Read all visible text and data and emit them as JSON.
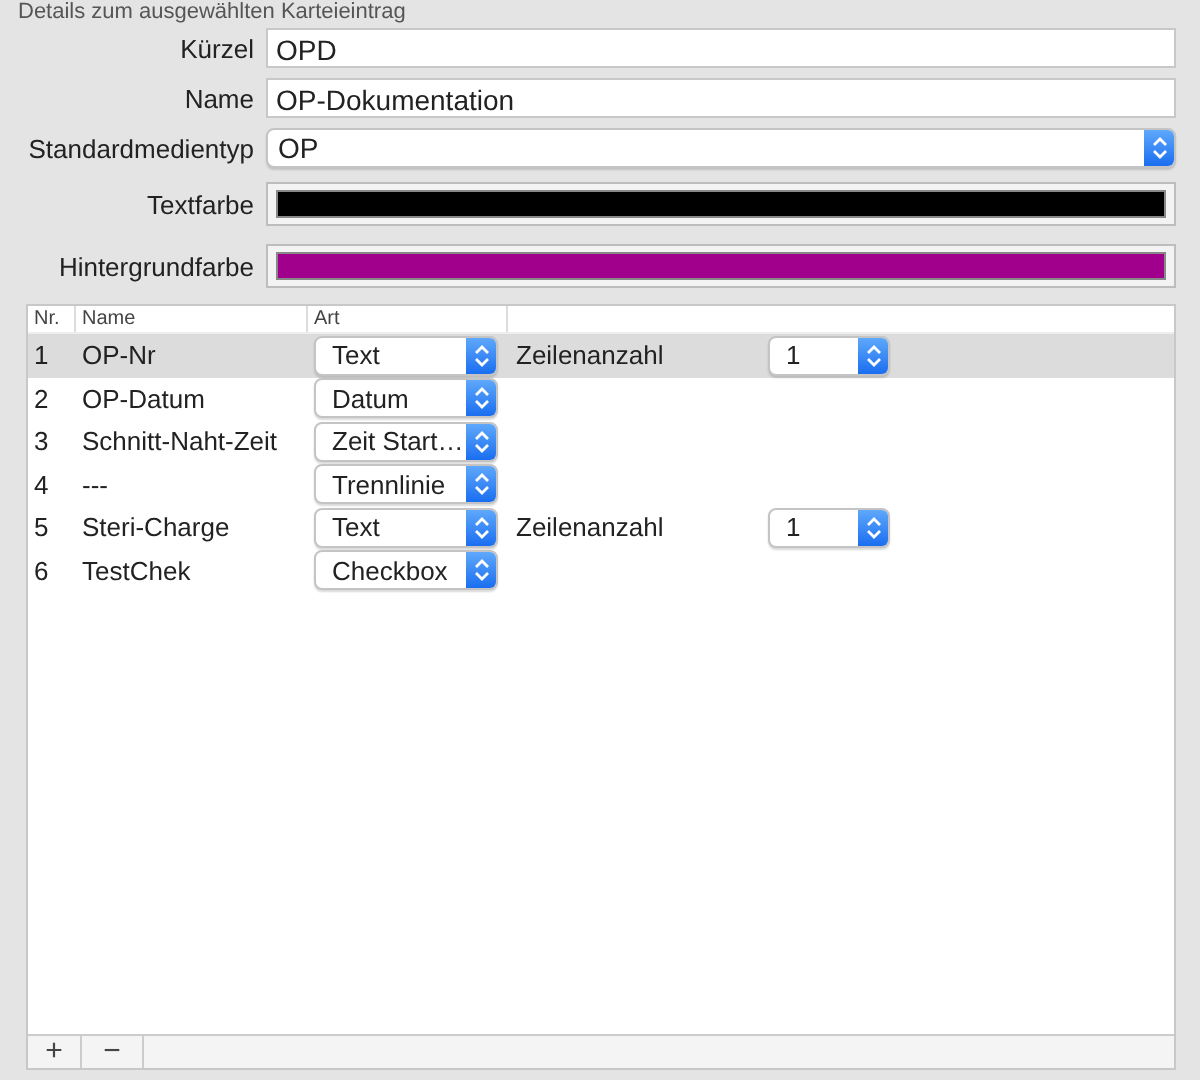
{
  "section_title": "Details zum ausgewählten Karteieintrag",
  "fields": [
    {
      "kind": "text",
      "label": "Kürzel",
      "value": "OPD"
    },
    {
      "kind": "text",
      "label": "Name",
      "value": "OP-Dokumentation"
    },
    {
      "kind": "popup",
      "label": "Standardmedientyp",
      "value": "OP"
    },
    {
      "kind": "color",
      "label": "Textfarbe",
      "color": "#000000"
    },
    {
      "kind": "color",
      "label": "Hintergrundfarbe",
      "color": "#a0008c"
    }
  ],
  "table": {
    "columns": [
      "Nr.",
      "Name",
      "Art"
    ],
    "rows": [
      {
        "nr": "1",
        "name": "OP-Nr",
        "type": "Text",
        "selected": true,
        "option_label": "Zeilenanzahl",
        "option_value": "1"
      },
      {
        "nr": "2",
        "name": "OP-Datum",
        "type": "Datum",
        "selected": false
      },
      {
        "nr": "3",
        "name": "Schnitt-Naht-Zeit",
        "type": "Zeit Start…",
        "selected": false
      },
      {
        "nr": "4",
        "name": "---",
        "type": "Trennlinie",
        "selected": false
      },
      {
        "nr": "5",
        "name": "Steri-Charge",
        "type": "Text",
        "selected": false,
        "option_label": "Zeilenanzahl",
        "option_value": "1"
      },
      {
        "nr": "6",
        "name": "TestChek",
        "type": "Checkbox",
        "selected": false
      }
    ],
    "footer_buttons": [
      "+",
      "−"
    ]
  }
}
